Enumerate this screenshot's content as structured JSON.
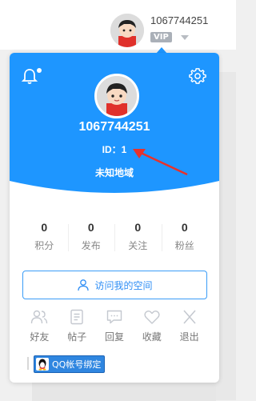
{
  "top": {
    "username": "1067744251",
    "badge": "VIP"
  },
  "card": {
    "username": "1067744251",
    "id_label": "ID：1",
    "region": "未知地域",
    "stats": [
      {
        "value": "0",
        "label": "积分"
      },
      {
        "value": "0",
        "label": "发布"
      },
      {
        "value": "0",
        "label": "关注"
      },
      {
        "value": "0",
        "label": "粉丝"
      }
    ],
    "visit_button": "访问我的空间",
    "actions": [
      {
        "label": "好友",
        "icon": "friends-icon"
      },
      {
        "label": "帖子",
        "icon": "posts-icon"
      },
      {
        "label": "回复",
        "icon": "reply-icon"
      },
      {
        "label": "收藏",
        "icon": "favorite-icon"
      },
      {
        "label": "退出",
        "icon": "logout-icon"
      }
    ],
    "qq_bind": "QQ帐号绑定"
  },
  "colors": {
    "header_blue": "#1e96ff",
    "accent_blue": "#2f8ef5",
    "arrow_red": "#e8322b"
  }
}
